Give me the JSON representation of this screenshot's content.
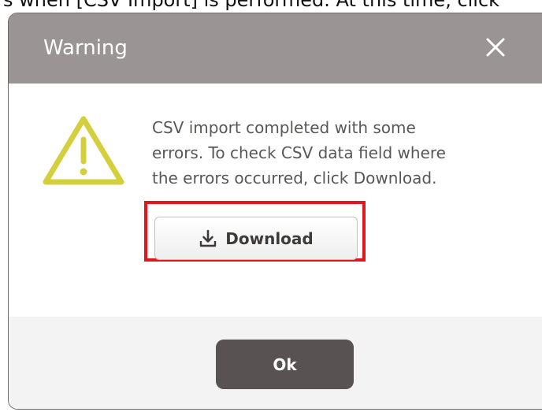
{
  "caption": {
    "text": "s when [CSV Import] is performed. At this time, click"
  },
  "dialog": {
    "title": "Warning",
    "close_icon": "close-icon",
    "message_lines": [
      "CSV import completed with some",
      "errors. To check CSV data field where",
      "the errors occurred, click Download."
    ],
    "warning_icon": "warning-triangle-icon",
    "download_button": {
      "label": "Download",
      "icon": "download-icon"
    },
    "ok_button": {
      "label": "Ok"
    }
  },
  "colors": {
    "header_bg": "#9a9494",
    "warning_icon": "#d4cf3c",
    "highlight": "#e8141c",
    "ok_bg": "#585252",
    "footer_bg": "#f4f3f3"
  }
}
